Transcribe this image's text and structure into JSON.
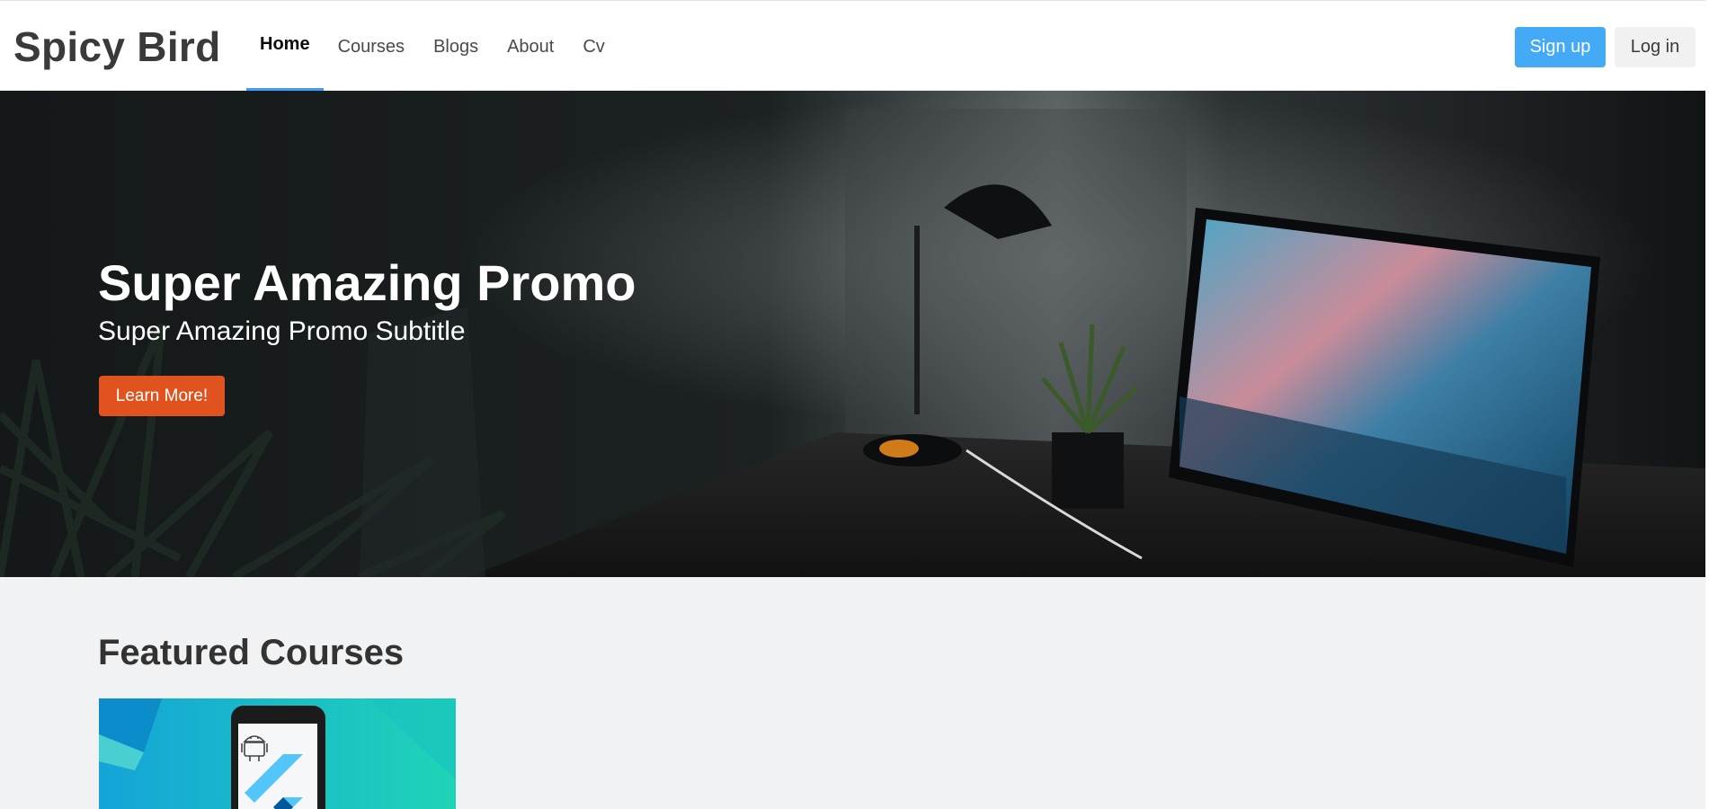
{
  "brand": "Spicy Bird",
  "nav": {
    "items": [
      {
        "label": "Home",
        "active": true
      },
      {
        "label": "Courses",
        "active": false
      },
      {
        "label": "Blogs",
        "active": false
      },
      {
        "label": "About",
        "active": false
      },
      {
        "label": "Cv",
        "active": false
      }
    ],
    "signup_label": "Sign up",
    "login_label": "Log in"
  },
  "hero": {
    "title": "Super Amazing Promo",
    "subtitle": "Super Amazing Promo Subtitle",
    "cta_label": "Learn More!"
  },
  "featured": {
    "heading": "Featured Courses"
  },
  "colors": {
    "accent": "#44aaf5",
    "active_underline": "#3f9cf0",
    "cta": "#e0531f",
    "page_bg": "#f1f2f4"
  },
  "icons": [
    "android-icon",
    "flutter-icon"
  ]
}
